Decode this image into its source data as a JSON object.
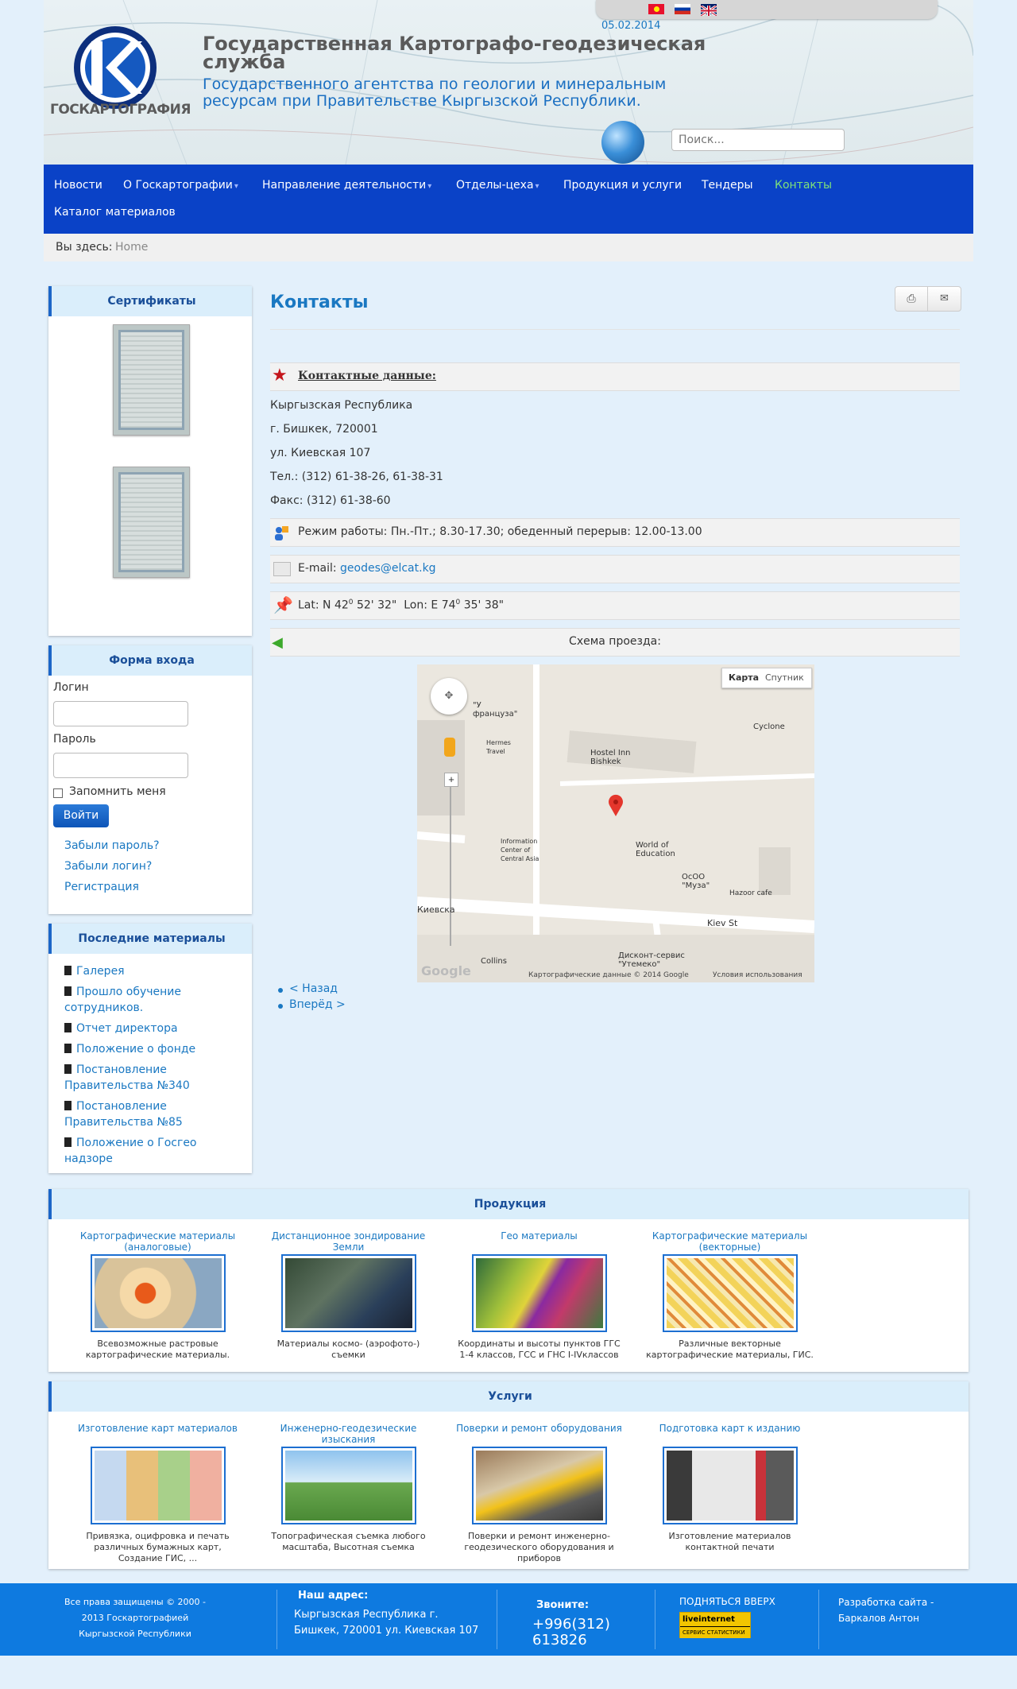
{
  "header": {
    "logo_text": "ГОСКАРТОГРАФИЯ",
    "title": "Государственная Картографо-геодезическая служба",
    "subtitle": "Государственного агентства по геологии и минеральным ресурсам при Правительстве Кыргызской Республики.",
    "date": "05.02.2014",
    "search_placeholder": "Поиск...",
    "languages": [
      "kg",
      "ru",
      "en"
    ]
  },
  "nav": {
    "items": [
      {
        "label": "Новости",
        "dropdown": false,
        "active": false
      },
      {
        "label": "О Госкартографии",
        "dropdown": true,
        "active": false
      },
      {
        "label": "Направление деятельности",
        "dropdown": true,
        "active": false
      },
      {
        "label": "Отделы-цеха",
        "dropdown": true,
        "active": false
      },
      {
        "label": "Продукция и услуги",
        "dropdown": false,
        "active": false
      },
      {
        "label": "Тендеры",
        "dropdown": false,
        "active": false
      },
      {
        "label": "Контакты",
        "dropdown": false,
        "active": true
      },
      {
        "label": "Каталог материалов",
        "dropdown": false,
        "active": false
      }
    ]
  },
  "breadcrumb": {
    "prefix": "Вы здесь:",
    "current": "Home"
  },
  "sidebar": {
    "certificates_title": "Сертификаты",
    "login": {
      "title": "Форма входа",
      "login_label": "Логин",
      "password_label": "Пароль",
      "remember_label": "Запомнить меня",
      "submit": "Войти",
      "links": [
        "Забыли пароль?",
        "Забыли логин?",
        "Регистрация"
      ]
    },
    "latest": {
      "title": "Последние материалы",
      "items": [
        "Галерея",
        "Прошло обучение сотрудников.",
        "Отчет директора",
        "Положение о фонде",
        "Постановление Правительства №340",
        "Постановление Правительства №85",
        "Положение о Госгео надзоре"
      ]
    }
  },
  "content": {
    "title": "Контакты",
    "contact_heading": "Контактные данные:",
    "country": "Кыргызская Республика",
    "city": "г. Бишкек, 720001",
    "street": "ул. Киевская 107",
    "phone": "Тел.: (312) 61-38-26, 61-38-31",
    "fax": "Факс: (312) 61-38-60",
    "hours": "Режим работы: Пн.-Пт.; 8.30-17.30; обеденный перерыв: 12.00-13.00",
    "email_label": "E-mail:",
    "email": "geodes@elcat.kg",
    "coords": {
      "lat_label": "Lat: N 42",
      "lat_sup": "0",
      "lat_rest": " 52' 32\"",
      "lon_label": "Lon: E 74",
      "lon_sup": "0",
      "lon_rest": " 35' 38\""
    },
    "route_label": "Схема проезда:",
    "map": {
      "tab_map": "Карта",
      "tab_sat": "Спутник",
      "labels": [
        "Cyclone",
        "Hermes Travel",
        "Hostel Inn Bishkek",
        "Information Center of Central Asia",
        "World of Education",
        "ОсОО \"Муза\"",
        "Hazoor cafe",
        "Kiev St",
        "Collins",
        "Дисконт-сервис \"Утемеко\"",
        "Киевска",
        "\"У француза\""
      ],
      "copyright": "Картографические данные © 2014 Google",
      "terms": "Условия использования",
      "google": "Google"
    },
    "pager": {
      "prev": "< Назад",
      "next": "Вперёд >"
    }
  },
  "products": {
    "title": "Продукция",
    "items": [
      {
        "title": "Картографические материалы (аналоговые)",
        "desc": "Всевозможные растровые картографические материалы."
      },
      {
        "title": "Дистанционное зондирование Земли",
        "desc": "Материалы космо- (аэрофото-) съемки"
      },
      {
        "title": "Гео материалы",
        "desc": "Координаты и высоты пунктов ГГС 1-4 классов, ГСС и ГНС I-IVклассов"
      },
      {
        "title": "Картографические материалы (векторные)",
        "desc": "Различные векторные картографические материалы, ГИС."
      }
    ]
  },
  "services": {
    "title": "Услуги",
    "items": [
      {
        "title": "Изготовление карт материалов",
        "desc": "Привязка, оцифровка и печать различных бумажных карт, Создание ГИС, ..."
      },
      {
        "title": "Инженерно-геодезические изыскания",
        "desc": "Топографическая съемка любого масштаба, Высотная съемка"
      },
      {
        "title": "Поверки и ремонт оборудования",
        "desc": "Поверки и ремонт инженерно-геодезического оборудования и приборов"
      },
      {
        "title": "Подготовка карт к изданию",
        "desc": "Изготовление материалов контактной печати"
      }
    ]
  },
  "footer": {
    "copyright": "Все права защищены © 2000 - 2013 Госкартографией Кыргызской Республики",
    "address_title": "Наш адрес:",
    "address": "Кыргызская Республика г. Бишкек, 720001 ул. Киевская 107",
    "call_title": "Звоните:",
    "phone": "+996(312) 613826",
    "up": "ПОДНЯТЬСЯ ВВЕРХ",
    "counter_top": "liveinternet",
    "counter_bottom": "СЕРВИС СТАТИСТИКИ",
    "dev": "Разработка сайта - Баркалов Антон"
  },
  "colors": {
    "nav": "#0a42c7",
    "accent": "#1a78c2",
    "footer": "#0e7ae0",
    "active_nav": "#7ee07a"
  }
}
